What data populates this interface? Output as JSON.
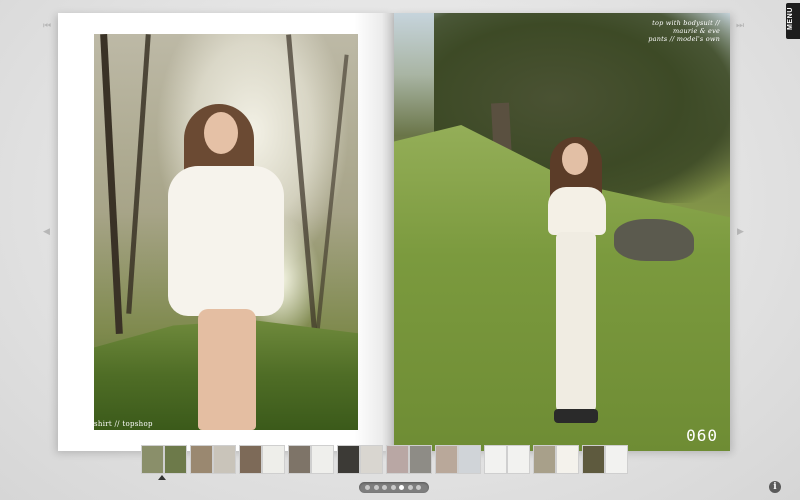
{
  "left_page": {
    "photo_caption": "shirt // topshop"
  },
  "right_page": {
    "credits": [
      "top with bodysuit //",
      "maurie & eve",
      "pants // model's own"
    ],
    "page_number": "060"
  },
  "menu": {
    "label": "MENU"
  },
  "navigation": {
    "first_icon": "skip-to-first-icon",
    "prev_icon": "previous-page-icon",
    "next_icon": "next-page-icon",
    "last_icon": "skip-to-last-icon",
    "first_glyph": "⏮",
    "prev_glyph": "◀",
    "next_glyph": "▶",
    "last_glyph": "⏭"
  },
  "thumbnails": [
    {
      "color": "#8a8f6a"
    },
    {
      "color": "#6d7a4a"
    },
    {
      "color": "#9a8870"
    },
    {
      "color": "#c9c4ba"
    },
    {
      "color": "#7d6a58"
    },
    {
      "color": "#eeeeea"
    },
    {
      "color": "#7e7468"
    },
    {
      "color": "#efefec"
    },
    {
      "color": "#3c3a36"
    },
    {
      "color": "#d9d6d0"
    },
    {
      "color": "#b9a7a4"
    },
    {
      "color": "#8e8c86"
    },
    {
      "color": "#b9a89a"
    },
    {
      "color": "#d0d4d8"
    },
    {
      "color": "#f2f2f0"
    },
    {
      "color": "#f2f2f0"
    },
    {
      "color": "#a8a08a"
    },
    {
      "color": "#f4f2ec"
    },
    {
      "color": "#5e5a3e"
    },
    {
      "color": "#f2f2f0"
    }
  ],
  "pager": {
    "count": 7,
    "active_index": 4
  },
  "info": {
    "glyph": "i"
  }
}
